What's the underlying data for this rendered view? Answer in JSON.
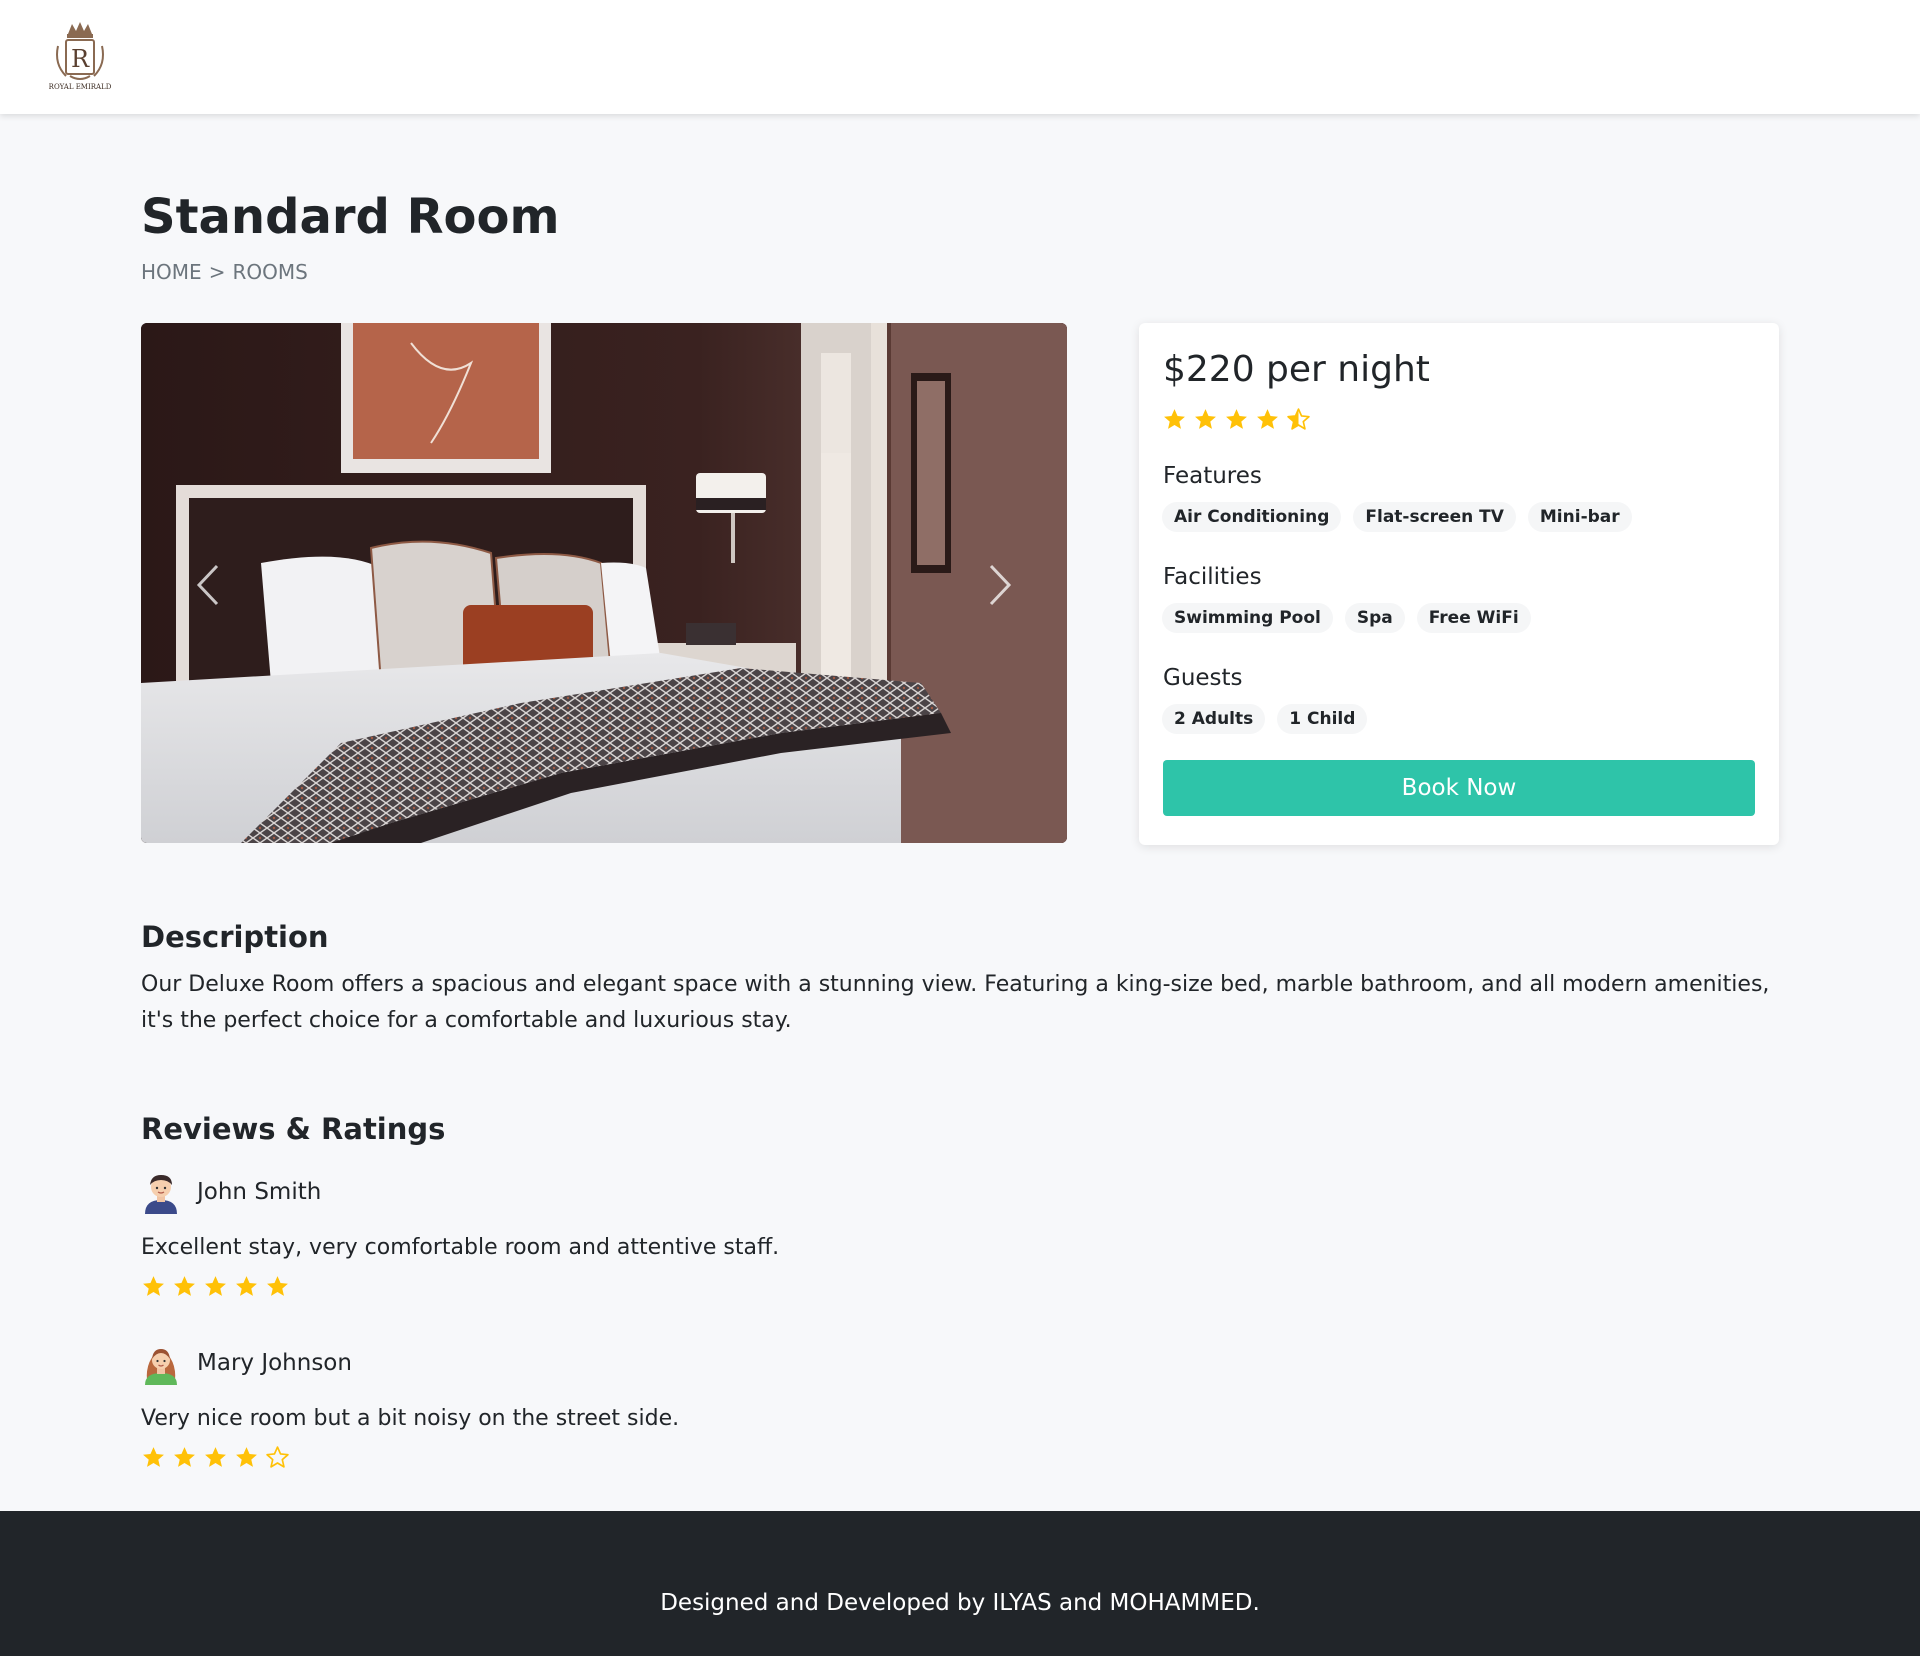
{
  "header": {
    "logo_text": "ROYAL EMIRALD",
    "logo_letter": "R"
  },
  "page": {
    "title": "Standard Room",
    "breadcrumb": [
      "HOME",
      ">",
      "ROOMS"
    ]
  },
  "carousel": {
    "prev_icon": "chevron-left-icon",
    "next_icon": "chevron-right-icon"
  },
  "booking": {
    "price": "$220 per night",
    "rating": 4.5,
    "features_label": "Features",
    "features": [
      "Air Conditioning",
      "Flat-screen TV",
      "Mini-bar"
    ],
    "facilities_label": "Facilities",
    "facilities": [
      "Swimming Pool",
      "Spa",
      "Free WiFi"
    ],
    "guests_label": "Guests",
    "guests": [
      "2 Adults",
      "1 Child"
    ],
    "book_label": "Book Now",
    "accent_color": "#2ec4a9",
    "star_color": "#ffc107"
  },
  "description": {
    "title": "Description",
    "text": "Our Deluxe Room offers a spacious and elegant space with a stunning view. Featuring a king-size bed, marble bathroom, and all modern amenities, it's the perfect choice for a comfortable and luxurious stay."
  },
  "reviews": {
    "title": "Reviews & Ratings",
    "items": [
      {
        "name": "John Smith",
        "avatar": "male-avatar-icon",
        "text": "Excellent stay, very comfortable room and attentive staff.",
        "rating": 5
      },
      {
        "name": "Mary Johnson",
        "avatar": "female-avatar-icon",
        "text": "Very nice room but a bit noisy on the street side.",
        "rating": 4
      }
    ]
  },
  "footer": {
    "text": "Designed and Developed by ILYAS and MOHAMMED."
  }
}
